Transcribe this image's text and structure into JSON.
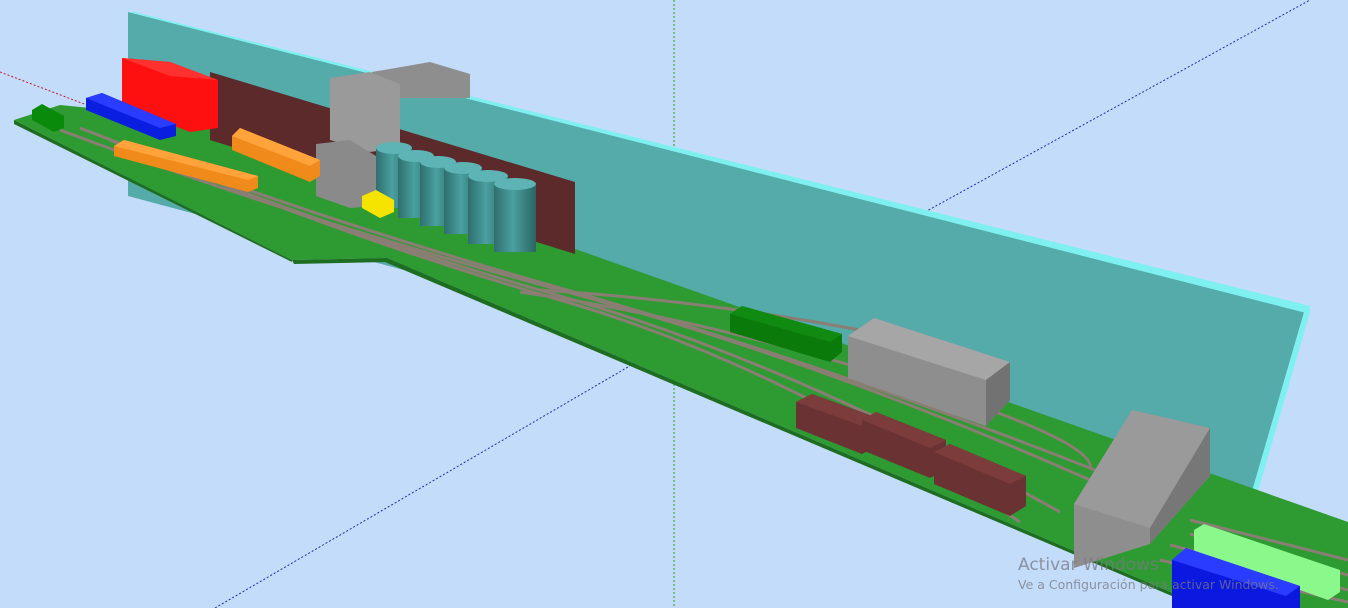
{
  "viewport": {
    "label": "",
    "background_color": "#c3dcfa",
    "axes": {
      "red_axis_color": "#c0182b",
      "green_axis_color": "#1aa01a",
      "blue_axis_color": "#1a2fa0"
    }
  },
  "scene": {
    "baseboard_color": "#2e9a32",
    "backdrop_color": "#55aaaa",
    "backdrop_edge_color": "#7ff0f0",
    "track_color": "#8a7e74",
    "objects": [
      {
        "id": "red-building",
        "color": "#ff1010"
      },
      {
        "id": "blue-wagons",
        "color": "#0a1ee0"
      },
      {
        "id": "green-wagon-left",
        "color": "#0a8a0a"
      },
      {
        "id": "brown-wall",
        "color": "#5c2a2a"
      },
      {
        "id": "gray-tower",
        "color": "#8e8e8e"
      },
      {
        "id": "silos",
        "color": "#3d8a8a",
        "count": 6
      },
      {
        "id": "orange-wagons",
        "color": "#f08a1a"
      },
      {
        "id": "yellow-block",
        "color": "#f4e400"
      },
      {
        "id": "green-wagon-right",
        "color": "#0a7a0a"
      },
      {
        "id": "gray-shed",
        "color": "#8e8e8e"
      },
      {
        "id": "brown-wagons",
        "color": "#6a3232",
        "count": 3
      },
      {
        "id": "gray-box-right",
        "color": "#8e8e8e"
      },
      {
        "id": "blue-wagon-right",
        "color": "#0a18e0"
      },
      {
        "id": "light-green-wagon",
        "color": "#8af88a"
      }
    ]
  },
  "watermark": {
    "title": "Activar Windows",
    "subtitle": "Ve a Configuración para activar Windows."
  }
}
